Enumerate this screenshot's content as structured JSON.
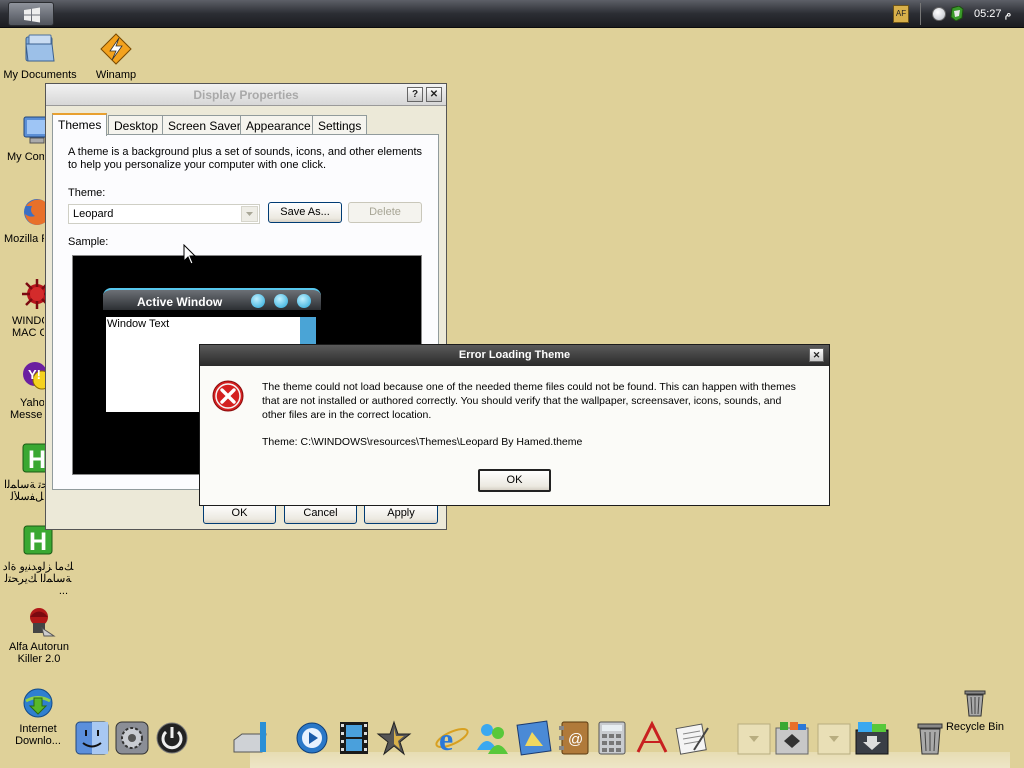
{
  "taskbar": {
    "language": "AF",
    "clock": "05:27 م"
  },
  "desktop_icons": [
    {
      "label": "My Documents",
      "icon": "folder-icon"
    },
    {
      "label": "Winamp",
      "icon": "winamp-icon"
    },
    {
      "label": "My Com",
      "icon": "computer-icon"
    },
    {
      "label": "Mozilla F",
      "icon": "firefox-icon"
    },
    {
      "label": "WINDO",
      "label2": "MAC O",
      "icon": "virus-icon"
    },
    {
      "label": "Yaho",
      "label2": "Messe",
      "icon": "yahoo-messenger-icon"
    },
    {
      "label": "ﻚﯾﺮﺤﺗ ﺔﺳﺎﻤﻟا",
      "label2": "ﻞﻔﺳﻸﻟ",
      "icon": "h-app-icon"
    },
    {
      "label": "ﻚﻣﺎ ﺰﻟوﺪﻨﯾو ةاد",
      "label2": "ﺔﺳﺎﻤﻟا ﻚﯾﺮﺤﺘﻟ",
      "label3": "...",
      "icon": "h-app-icon-2"
    },
    {
      "label": "Alfa Autorun",
      "label2": "Killer 2.0",
      "icon": "alfa-autorun-icon"
    },
    {
      "label": "Internet",
      "label2": "Downlo...",
      "icon": "internet-download-icon"
    },
    {
      "label": "Recycle Bin",
      "icon": "recycle-bin-icon"
    }
  ],
  "display_properties": {
    "title": "Display Properties",
    "help_btn": "?",
    "close_btn": "✕",
    "tabs": [
      "Themes",
      "Desktop",
      "Screen Saver",
      "Appearance",
      "Settings"
    ],
    "description_line1": "A theme is a background plus a set of sounds, icons, and other elements",
    "description_line2": "to help you personalize your computer with one click.",
    "theme_label": "Theme:",
    "theme_value": "Leopard",
    "save_as": "Save As...",
    "delete": "Delete",
    "sample_label": "Sample:",
    "sample_active_window": "Active Window",
    "sample_window_text": "Window Text",
    "ok": "OK",
    "cancel": "Cancel",
    "apply": "Apply"
  },
  "error_dialog": {
    "title": "Error Loading Theme",
    "close_btn": "✕",
    "line1": "The theme could not load because one of the needed theme files could not be found.  This can happen with themes",
    "line2": "that are not installed or authored correctly.  You should verify that the wallpaper, screensaver, icons, sounds, and",
    "line3": "other files are in the correct location.",
    "theme_path": "Theme: C:\\WINDOWS\\resources\\Themes\\Leopard By Hamed.theme",
    "ok": "OK"
  },
  "colors": {
    "desktop": "#dfd199",
    "error_title_bg": "#3a3a3a",
    "tab_accent": "#e8a030",
    "error_red": "#d42020"
  }
}
